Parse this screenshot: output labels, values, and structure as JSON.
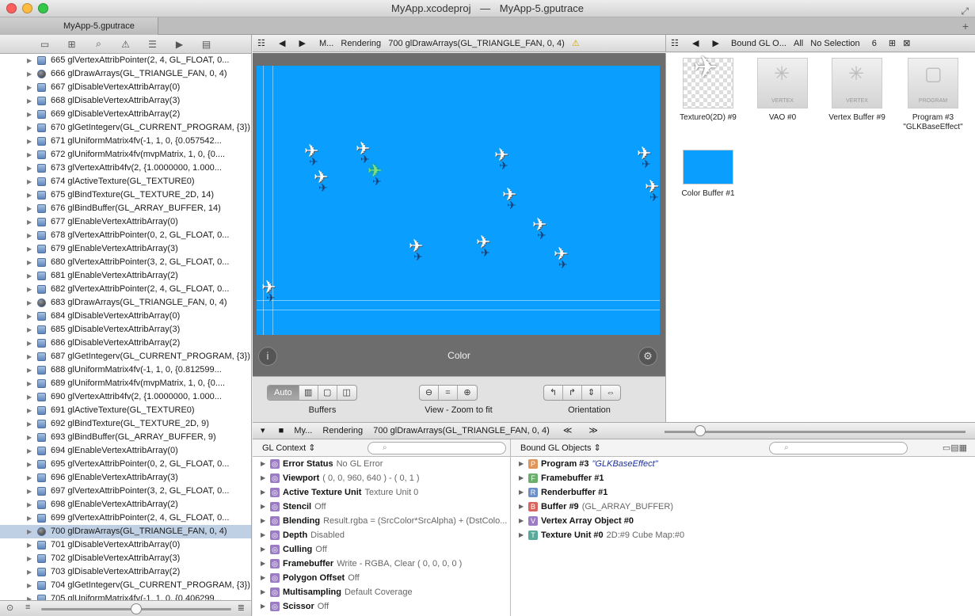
{
  "window": {
    "title_project": "MyApp.xcodeproj",
    "title_sep": "—",
    "title_trace": "MyApp-5.gputrace",
    "tab": "MyApp-5.gputrace",
    "plus": "+",
    "fullscreen": "⤢"
  },
  "trace": {
    "items": [
      {
        "label": "665 glVertexAttribPointer(2, 4, GL_FLOAT, 0...",
        "icon": "cube"
      },
      {
        "label": "666 glDrawArrays(GL_TRIANGLE_FAN, 0, 4)",
        "icon": "sphere"
      },
      {
        "label": "667 glDisableVertexAttribArray(0)",
        "icon": "cube"
      },
      {
        "label": "668 glDisableVertexAttribArray(3)",
        "icon": "cube"
      },
      {
        "label": "669 glDisableVertexAttribArray(2)",
        "icon": "cube"
      },
      {
        "label": "670 glGetIntegerv(GL_CURRENT_PROGRAM, {3})",
        "icon": "cube"
      },
      {
        "label": "671 glUniformMatrix4fv(-1, 1, 0, {0.057542...",
        "icon": "cube"
      },
      {
        "label": "672 glUniformMatrix4fv(mvpMatrix, 1, 0, {0....",
        "icon": "cube"
      },
      {
        "label": "673 glVertexAttrib4fv(2, {1.0000000, 1.000...",
        "icon": "cube"
      },
      {
        "label": "674 glActiveTexture(GL_TEXTURE0)",
        "icon": "cube"
      },
      {
        "label": "675 glBindTexture(GL_TEXTURE_2D, 14)",
        "icon": "cube"
      },
      {
        "label": "676 glBindBuffer(GL_ARRAY_BUFFER, 14)",
        "icon": "cube"
      },
      {
        "label": "677 glEnableVertexAttribArray(0)",
        "icon": "cube"
      },
      {
        "label": "678 glVertexAttribPointer(0, 2, GL_FLOAT, 0...",
        "icon": "cube"
      },
      {
        "label": "679 glEnableVertexAttribArray(3)",
        "icon": "cube"
      },
      {
        "label": "680 glVertexAttribPointer(3, 2, GL_FLOAT, 0...",
        "icon": "cube"
      },
      {
        "label": "681 glEnableVertexAttribArray(2)",
        "icon": "cube"
      },
      {
        "label": "682 glVertexAttribPointer(2, 4, GL_FLOAT, 0...",
        "icon": "cube"
      },
      {
        "label": "683 glDrawArrays(GL_TRIANGLE_FAN, 0, 4)",
        "icon": "sphere"
      },
      {
        "label": "684 glDisableVertexAttribArray(0)",
        "icon": "cube"
      },
      {
        "label": "685 glDisableVertexAttribArray(3)",
        "icon": "cube"
      },
      {
        "label": "686 glDisableVertexAttribArray(2)",
        "icon": "cube"
      },
      {
        "label": "687 glGetIntegerv(GL_CURRENT_PROGRAM, {3})",
        "icon": "cube"
      },
      {
        "label": "688 glUniformMatrix4fv(-1, 1, 0, {0.812599...",
        "icon": "cube"
      },
      {
        "label": "689 glUniformMatrix4fv(mvpMatrix, 1, 0, {0....",
        "icon": "cube"
      },
      {
        "label": "690 glVertexAttrib4fv(2, {1.0000000, 1.000...",
        "icon": "cube"
      },
      {
        "label": "691 glActiveTexture(GL_TEXTURE0)",
        "icon": "cube"
      },
      {
        "label": "692 glBindTexture(GL_TEXTURE_2D, 9)",
        "icon": "cube"
      },
      {
        "label": "693 glBindBuffer(GL_ARRAY_BUFFER, 9)",
        "icon": "cube"
      },
      {
        "label": "694 glEnableVertexAttribArray(0)",
        "icon": "cube"
      },
      {
        "label": "695 glVertexAttribPointer(0, 2, GL_FLOAT, 0...",
        "icon": "cube"
      },
      {
        "label": "696 glEnableVertexAttribArray(3)",
        "icon": "cube"
      },
      {
        "label": "697 glVertexAttribPointer(3, 2, GL_FLOAT, 0...",
        "icon": "cube"
      },
      {
        "label": "698 glEnableVertexAttribArray(2)",
        "icon": "cube"
      },
      {
        "label": "699 glVertexAttribPointer(2, 4, GL_FLOAT, 0...",
        "icon": "cube"
      },
      {
        "label": "700 glDrawArrays(GL_TRIANGLE_FAN, 0, 4)",
        "icon": "sphere",
        "selected": true
      },
      {
        "label": "701 glDisableVertexAttribArray(0)",
        "icon": "cube"
      },
      {
        "label": "702 glDisableVertexAttribArray(3)",
        "icon": "cube"
      },
      {
        "label": "703 glDisableVertexAttribArray(2)",
        "icon": "cube"
      },
      {
        "label": "704 glGetIntegerv(GL_CURRENT_PROGRAM, {3})",
        "icon": "cube"
      },
      {
        "label": "705 glUniformMatrix4fv(-1, 1, 0, {0.406299...",
        "icon": "cube"
      }
    ]
  },
  "center_jump": {
    "crumb1": "M...",
    "crumb2": "Rendering",
    "crumb3": "700 glDrawArrays(GL_TRIANGLE_FAN, 0, 4)",
    "warn": "⚠"
  },
  "right_jump": {
    "crumb1": "Bound GL O...",
    "crumb2": "All",
    "crumb3": "No Selection",
    "count": "6"
  },
  "viewer": {
    "label": "Color",
    "info": "i",
    "gear": "⚙"
  },
  "controls": {
    "auto": "Auto",
    "buffers": "Buffers",
    "view": "View - Zoom to fit",
    "orientation": "Orientation"
  },
  "bound_objects": [
    {
      "label": "Texture0(2D) #9",
      "kind": "tex",
      "text": ""
    },
    {
      "label": "VAO #0",
      "kind": "vao",
      "text": "VERTEX"
    },
    {
      "label": "Vertex Buffer #9",
      "kind": "vb",
      "text": "VERTEX"
    },
    {
      "label": "Program #3 \"GLKBaseEffect\"",
      "kind": "prog",
      "text": "PROGRAM"
    },
    {
      "label": "Color Buffer #1",
      "kind": "cb",
      "text": ""
    }
  ],
  "debug_bar": {
    "crumb1": "My...",
    "crumb2": "Rendering",
    "crumb3": "700 glDrawArrays(GL_TRIANGLE_FAN, 0, 4)",
    "prev": "≪",
    "next": "≫"
  },
  "gl_context": {
    "title": "GL Context ⇕",
    "rows": [
      {
        "name": "Error Status",
        "value": "No GL Error"
      },
      {
        "name": "Viewport",
        "value": "( 0, 0, 960, 640 ) - ( 0, 1 )"
      },
      {
        "name": "Active Texture Unit",
        "value": "Texture Unit 0"
      },
      {
        "name": "Stencil",
        "value": "Off"
      },
      {
        "name": "Blending",
        "value": "Result.rgba = (SrcColor*SrcAlpha) + (DstColo..."
      },
      {
        "name": "Depth",
        "value": "Disabled"
      },
      {
        "name": "Culling",
        "value": "Off"
      },
      {
        "name": "Framebuffer",
        "value": "Write - RGBA, Clear ( 0, 0, 0, 0 )"
      },
      {
        "name": "Polygon Offset",
        "value": "Off"
      },
      {
        "name": "Multisampling",
        "value": "Default Coverage"
      },
      {
        "name": "Scissor",
        "value": "Off"
      }
    ]
  },
  "bound_gl": {
    "title": "Bound GL Objects ⇕",
    "rows": [
      {
        "letter": "P",
        "color": "#e0955a",
        "name": "Program #3",
        "value": "\"GLKBaseEffect\"",
        "blue": true
      },
      {
        "letter": "F",
        "color": "#6cae6c",
        "name": "Framebuffer #1",
        "value": ""
      },
      {
        "letter": "R",
        "color": "#6b8fc9",
        "name": "Renderbuffer #1",
        "value": ""
      },
      {
        "letter": "B",
        "color": "#d9645e",
        "name": "Buffer #9",
        "value": "(GL_ARRAY_BUFFER)"
      },
      {
        "letter": "V",
        "color": "#9b7cc4",
        "name": "Vertex Array Object #0",
        "value": ""
      },
      {
        "letter": "T",
        "color": "#5aaa9b",
        "name": "Texture Unit #0",
        "value": "2D:#9   Cube Map:#0"
      }
    ]
  }
}
